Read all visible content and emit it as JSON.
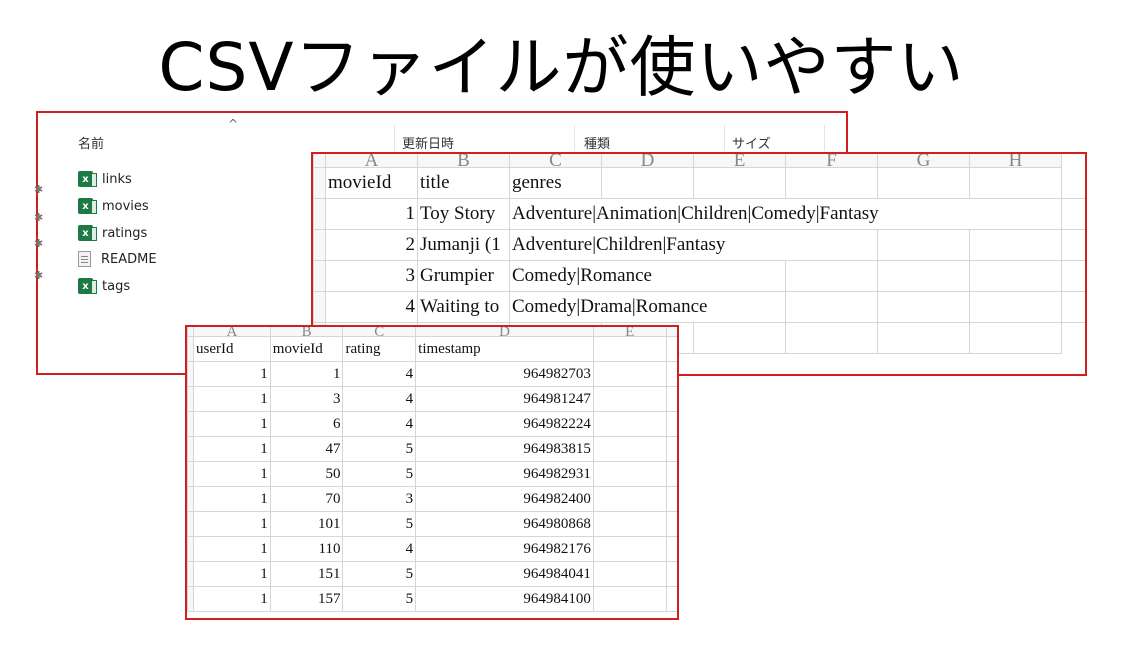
{
  "slide": {
    "title": "CSVファイルが使いやすい"
  },
  "explorer": {
    "columns": [
      "名前",
      "更新日時",
      "種類",
      "サイズ"
    ],
    "files": [
      {
        "name": "links",
        "icon": "excel-csv-icon"
      },
      {
        "name": "movies",
        "icon": "excel-csv-icon"
      },
      {
        "name": "ratings",
        "icon": "excel-csv-icon"
      },
      {
        "name": "README",
        "icon": "text-file-icon"
      },
      {
        "name": "tags",
        "icon": "excel-csv-icon"
      }
    ]
  },
  "movies_sheet": {
    "col_letters": [
      "A",
      "B",
      "C",
      "D",
      "E",
      "F",
      "G",
      "H"
    ],
    "headers": [
      "movieId",
      "title",
      "genres"
    ],
    "rows": [
      {
        "movieId": "1",
        "title": "Toy Story",
        "genres": "Adventure|Animation|Children|Comedy|Fantasy"
      },
      {
        "movieId": "2",
        "title": "Jumanji (1",
        "genres": "Adventure|Children|Fantasy"
      },
      {
        "movieId": "3",
        "title": "Grumpier",
        "genres": "Comedy|Romance"
      },
      {
        "movieId": "4",
        "title": "Waiting to",
        "genres": "Comedy|Drama|Romance"
      }
    ]
  },
  "ratings_sheet": {
    "col_letters": [
      "A",
      "B",
      "C",
      "D",
      "E"
    ],
    "headers": [
      "userId",
      "movieId",
      "rating",
      "timestamp"
    ],
    "rows": [
      {
        "userId": "1",
        "movieId": "1",
        "rating": "4",
        "timestamp": "964982703"
      },
      {
        "userId": "1",
        "movieId": "3",
        "rating": "4",
        "timestamp": "964981247"
      },
      {
        "userId": "1",
        "movieId": "6",
        "rating": "4",
        "timestamp": "964982224"
      },
      {
        "userId": "1",
        "movieId": "47",
        "rating": "5",
        "timestamp": "964983815"
      },
      {
        "userId": "1",
        "movieId": "50",
        "rating": "5",
        "timestamp": "964982931"
      },
      {
        "userId": "1",
        "movieId": "70",
        "rating": "3",
        "timestamp": "964982400"
      },
      {
        "userId": "1",
        "movieId": "101",
        "rating": "5",
        "timestamp": "964980868"
      },
      {
        "userId": "1",
        "movieId": "110",
        "rating": "4",
        "timestamp": "964982176"
      },
      {
        "userId": "1",
        "movieId": "151",
        "rating": "5",
        "timestamp": "964984041"
      },
      {
        "userId": "1",
        "movieId": "157",
        "rating": "5",
        "timestamp": "964984100"
      }
    ]
  },
  "colors": {
    "highlight_border": "#d21e1e",
    "excel_green": "#1d7a45"
  }
}
